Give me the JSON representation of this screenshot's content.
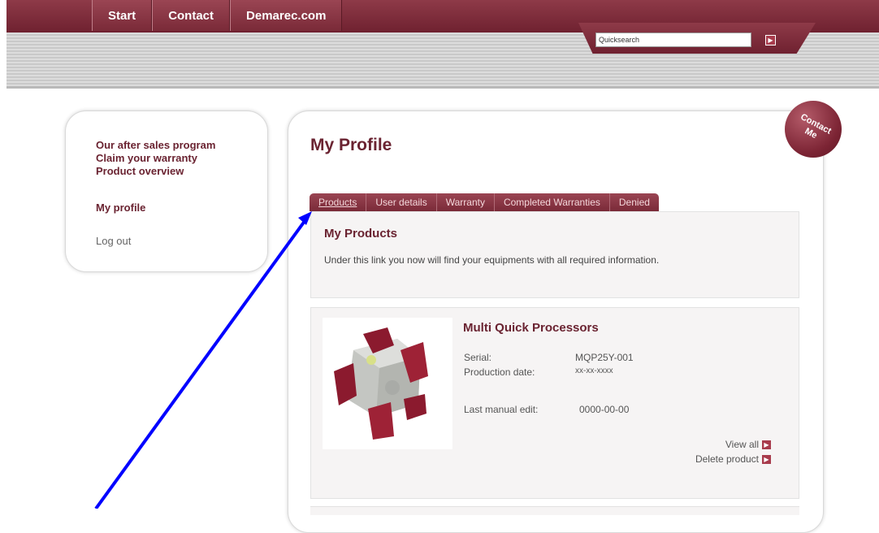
{
  "header": {
    "nav": [
      "Start",
      "Contact",
      "Demarec.com"
    ],
    "search": {
      "value": "Quicksearch"
    }
  },
  "sidebar": {
    "items": [
      {
        "label": "Our after sales program"
      },
      {
        "label": "Claim your warranty"
      },
      {
        "label": "Product overview"
      },
      {
        "label": "My profile"
      },
      {
        "label": "Log out"
      }
    ]
  },
  "main": {
    "title": "My Profile",
    "badge": "Contact Me",
    "tabs": [
      "Products",
      "User details",
      "Warranty",
      "Completed Warranties",
      "Denied"
    ],
    "active_tab": "Products",
    "info": {
      "title": "My Products",
      "text": "Under this link you now will find your equipments with all required information."
    },
    "product": {
      "name": "Multi Quick Processors",
      "serial_label": "Serial:",
      "serial_value": "MQP25Y-001",
      "production_label": "Production date:",
      "production_value": "xx-xx-xxxx",
      "edit_label": "Last manual edit:",
      "edit_value": "0000-00-00",
      "view_all": "View all",
      "delete": "Delete product"
    }
  },
  "colors": {
    "brand": "#7a2a38",
    "accent": "#a83b4c",
    "arrow": "#0000ff"
  }
}
